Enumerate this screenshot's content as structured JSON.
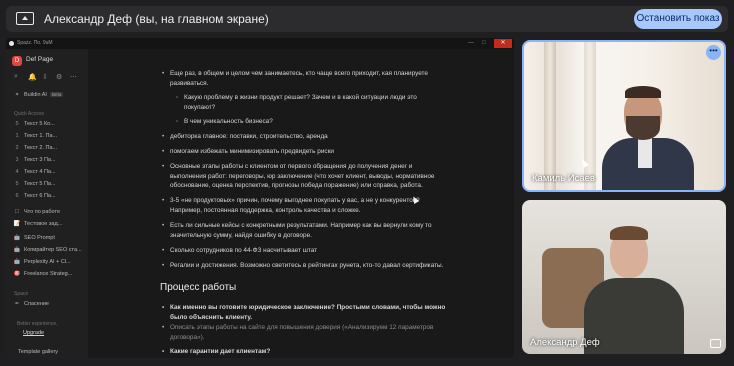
{
  "banner": {
    "title": "Александр Деф (вы, на главном экране)",
    "stop_label": "Остановить показ"
  },
  "shared_window": {
    "titlebar_text": "Spazz. По. 9uM",
    "window_controls": [
      "—",
      "□"
    ],
    "close_glyph": "✕",
    "sidebar": {
      "workspace_name": "Def Page",
      "workspace_logo": "D",
      "tools": [
        "⌕",
        "🔔",
        "⇩",
        "⚙",
        "⋯"
      ],
      "ai_item": "Buildin AI",
      "ai_badge": "Beta",
      "quick_access_label": "Quick Access",
      "items": [
        {
          "icon": "5",
          "label": "Текст 5 Ко..."
        },
        {
          "icon": "1",
          "label": "Текст 1. Па..."
        },
        {
          "icon": "2",
          "label": "Текст 2. Па..."
        },
        {
          "icon": "3",
          "label": "Текст 3 Па..."
        },
        {
          "icon": "4",
          "label": "Текст 4 Па..."
        },
        {
          "icon": "5",
          "label": "Текст 5 Па..."
        },
        {
          "icon": "6",
          "label": "Текст 6 Па..."
        }
      ],
      "misc_items": [
        {
          "icon": "☐",
          "label": "Что по работе"
        },
        {
          "icon": "📝",
          "label": "Тестовое зад..."
        },
        {
          "icon": "🤖",
          "label": "SEO Prompt"
        },
        {
          "icon": "🤖",
          "label": "Копирайтер SEO ста..."
        },
        {
          "icon": "🤖",
          "label": "Perplexity AI + Cl..."
        },
        {
          "icon": "🎯",
          "label": "Freelance Strateg..."
        }
      ],
      "space_label": "Space",
      "space_items": [
        {
          "icon": "✒",
          "label": "Спасение"
        }
      ],
      "upgrade_hint": "Better experience,",
      "upgrade_link": "Upgrade",
      "template_gallery": "Template gallery"
    },
    "content": {
      "b1": "Еще раз, в общем и целом чем занимаетесь, кто чаще всего приходит, кая планируете развиваться.",
      "s1": "Какую проблему в жизни продукт решает? Зачем и в какой ситуации люди это покупают?",
      "s2": "В чем уникальность бизнеса?",
      "b2": "дебиторка главное: поставки, строительство, аренда",
      "b3": "помогаем избежать минимизировать предвидеть риски",
      "b4": "Основные этапы работы с клиентом от первого обращения до получения денег и выполнения работ: переговоры, юр заключение (что хочет клиент, выводы, нормативное обоснование, оценка перспектив, прогнозы победа поражение) или справка, работа.",
      "b5": "3-5 «не продуктовых» причин, почему выгоднее покупать у вас, а не у конкурентов? Например, постоянная поддержка, контроль качества и сложке.",
      "b6": "Есть ли сильные кейсы с конкретными результатами. Например как вы вернули кому то значительную сумму, найдя ошибку в договоре.",
      "b7": "Сколько сотрудников по 44-ФЗ насчитывает штат",
      "b8": "Регалии и достижения. Возможно светитесь в рейтингах рунета, кто-то давал сертификаты.",
      "heading": "Процесс работы",
      "b9": "Как именно вы готовите юридическое заключение? Простыми словами, чтобы можно было объяснить клиенту.",
      "b9_hint": "Описать этапы работы на сайте для повышения доверия («Анализируем 12 параметров договора»).",
      "b10": "Какие гарантии дает клиентам?"
    }
  },
  "participants": [
    {
      "name": "Камиль Исаев",
      "more_glyph": "•••"
    },
    {
      "name": "Александр Деф"
    }
  ]
}
